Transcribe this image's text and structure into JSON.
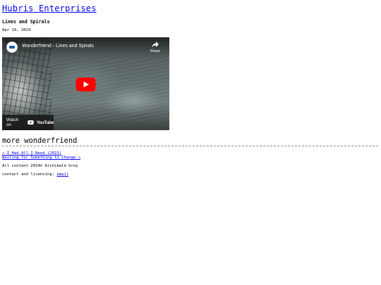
{
  "site": {
    "title": "Hubris Enterprises"
  },
  "post": {
    "title": "Lines and Spirals",
    "date": "Apr 19, 2024"
  },
  "video": {
    "title": "Wonderfriend - Lines and Spirals",
    "share_label": "Share",
    "watch_on_label": "Watch on",
    "youtube_wordmark": "YouTube",
    "play_icon": "play-icon",
    "share_icon": "share-icon",
    "accent_color": "#ff0000"
  },
  "more": {
    "heading": "more wonderfriend",
    "prev_link": "« I Had All I Need (2023)",
    "next_link": "Waiting for Something to Change »"
  },
  "footer": {
    "copyright": "All content 2024© Archibald Grey",
    "contact_label": "contact and licensing:",
    "email_link": "email"
  },
  "colors": {
    "link": "#0000ee",
    "text": "#000000"
  }
}
